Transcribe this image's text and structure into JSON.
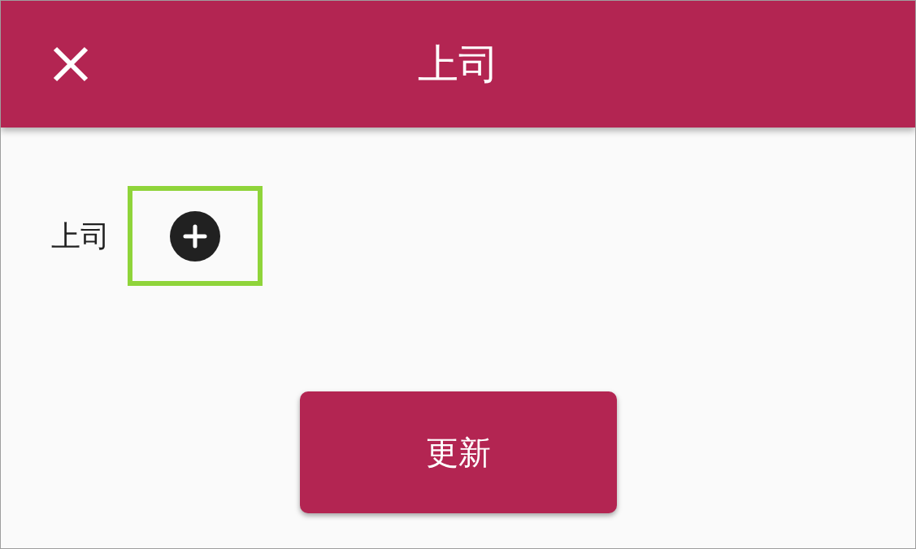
{
  "app_bar": {
    "title": "上司"
  },
  "field": {
    "label": "上司",
    "add_button": {
      "highlighted": true
    }
  },
  "submit_button": {
    "label": "更新"
  }
}
